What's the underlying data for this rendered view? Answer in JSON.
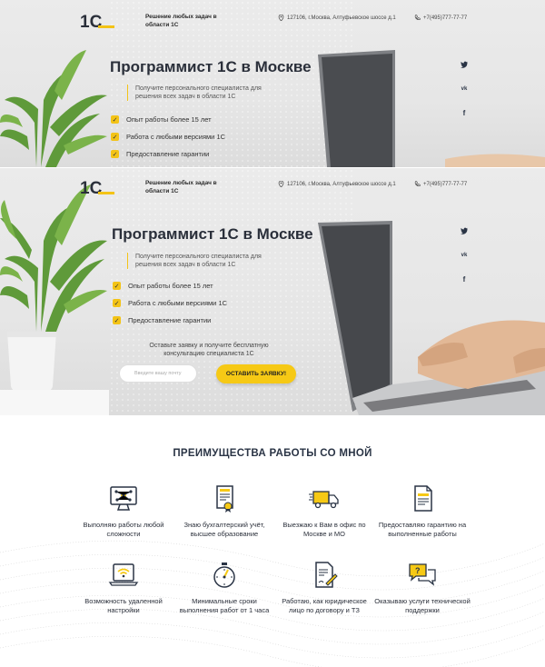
{
  "brand": {
    "logo_text": "1C",
    "tagline": "Решение любых задач в области 1С"
  },
  "contacts": {
    "address": "127106, г.Москва, Алтуфьевское шоссе д.1",
    "phone": "+7(495)777-77-77"
  },
  "hero": {
    "title": "Программист 1С в Москве",
    "subtitle": "Получите персонального специалиста для решения всех задач в области 1С",
    "features": [
      "Опыт работы более 15 лет",
      "Работа с любыми версиями 1С",
      "Предоставление гарантии"
    ]
  },
  "social": {
    "twitter": "🐦",
    "vk": "vk",
    "facebook": "f"
  },
  "cta": {
    "text": "Оставьте заявку и получите бесплатную консультацию специалиста 1С",
    "email_placeholder": "Введите вашу почту",
    "button_label": "ОСТАВИТЬ ЗАЯВКУ!"
  },
  "advantages": {
    "title": "ПРЕИМУЩЕСТВА РАБОТЫ СО МНОЙ",
    "items": [
      {
        "label": "Выполняю работы любой сложности",
        "icon": "network-monitor-icon"
      },
      {
        "label": "Знаю бухгалтерский учёт, высшее образование",
        "icon": "certificate-icon"
      },
      {
        "label": "Выезжаю к Вам в офис по Москве и МО",
        "icon": "delivery-truck-icon"
      },
      {
        "label": "Предоставляю гарантию на выполненные работы",
        "icon": "guarantee-document-icon"
      },
      {
        "label": "Возможность удаленной настройки",
        "icon": "remote-wifi-icon"
      },
      {
        "label": "Минимальные сроки выполнения работ от 1 часа",
        "icon": "stopwatch-icon"
      },
      {
        "label": "Работаю, как юридическое лицо по договору и ТЗ",
        "icon": "contract-icon"
      },
      {
        "label": "Оказываю услуги технической поддержки",
        "icon": "support-chat-icon"
      }
    ]
  },
  "colors": {
    "accent": "#f6c915",
    "dark": "#2a3445"
  }
}
